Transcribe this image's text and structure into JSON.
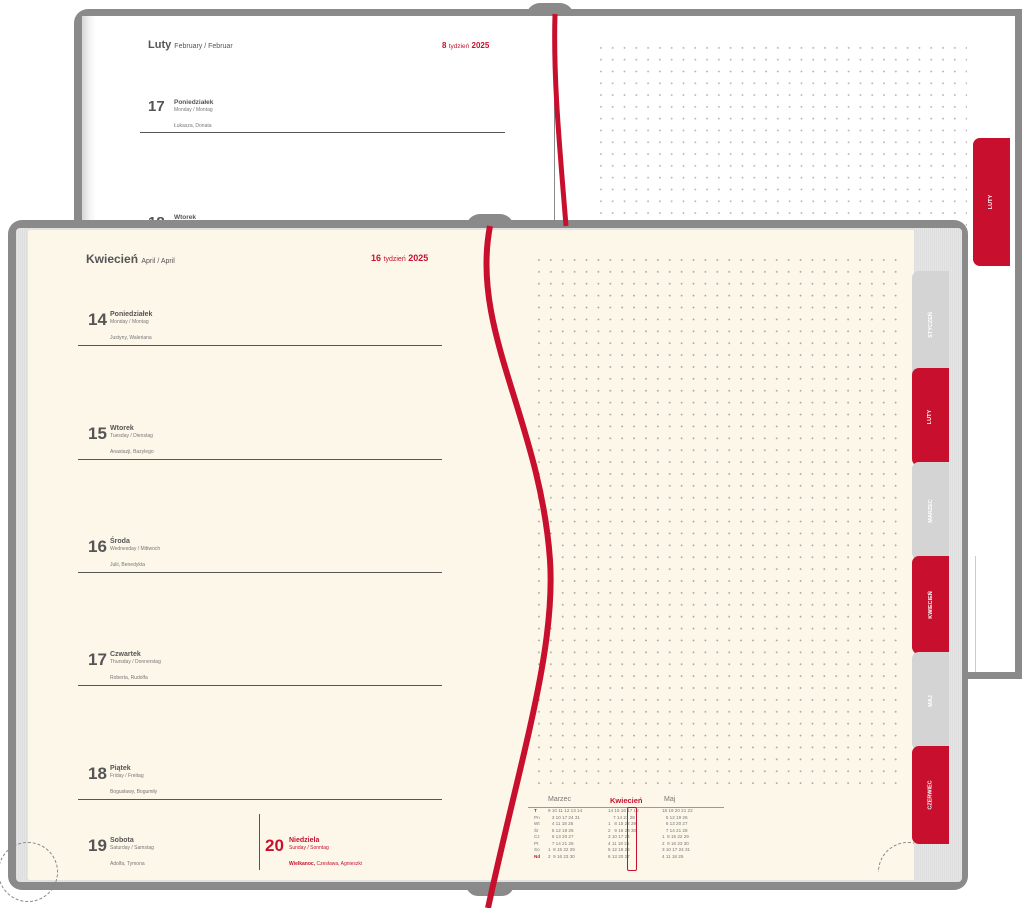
{
  "back_page": {
    "month": "Luty",
    "month_sub": "February / Februar",
    "week_num": "8",
    "week_word": "tydzień",
    "year": "2025",
    "day1": {
      "num": "17",
      "name": "Poniedziałek",
      "sub": "Monday / Montag",
      "names": "Łukasza, Donata"
    },
    "day2": {
      "num": "18",
      "name": "Wtorek"
    },
    "tab_label": "LUTY"
  },
  "front_page": {
    "month": "Kwiecień",
    "month_sub": "April / April",
    "week_num": "16",
    "week_word": "tydzień",
    "year": "2025",
    "days": [
      {
        "num": "14",
        "name": "Poniedziałek",
        "sub": "Monday / Montag",
        "names": "Justyny, Waleriana"
      },
      {
        "num": "15",
        "name": "Wtorek",
        "sub": "Tuesday / Dienstag",
        "names": "Anastazji, Bazylego"
      },
      {
        "num": "16",
        "name": "Środa",
        "sub": "Wednesday / Mittwoch",
        "names": "Julii, Benedykta"
      },
      {
        "num": "17",
        "name": "Czwartek",
        "sub": "Thursday / Donnerstag",
        "names": "Roberta, Rudolfa"
      },
      {
        "num": "18",
        "name": "Piątek",
        "sub": "Friday / Freitag",
        "names": "Bogusławy, Bogumiły"
      }
    ],
    "saturday": {
      "num": "19",
      "name": "Sobota",
      "sub": "Saturday / Samstag",
      "names": "Adolfa, Tymona"
    },
    "sunday": {
      "num": "20",
      "name": "Niedziela",
      "sub": "Sunday / Sonntag",
      "holiday": "Wielkanoc,",
      "names": "Czesława, Agnieszki"
    }
  },
  "tabs": [
    "STYCZEŃ",
    "LUTY",
    "MARZEC",
    "KWIECIEŃ",
    "MAJ",
    "CZERWIEC"
  ],
  "mini_calendar": {
    "months": [
      "Marzec",
      "Kwiecień",
      "Maj"
    ],
    "weekdays": [
      "T",
      "Pn",
      "Wt",
      "Śr",
      "Cz",
      "Pt",
      "So",
      "Nd"
    ],
    "marzec_cols": "9 10 11 12 13 14\n   3 10 17 24 31\n   4 11 18 25\n   5 12 19 26\n   6 13 20 27\n   7 14 21 28\n1  8 15 22 29\n2  9 16 23 30",
    "kwiecien_cols": "14 15 16 17 18\n    7 14 21 28\n1   8 15 22 29\n2   9 16 23 30\n3 10 17 24\n4 11 18 25\n5 12 19 26\n6 13 20 27",
    "maj_cols": "18 19 20 21 22\n   5 12 19 26\n   6 13 20 27\n   7 14 21 28\n1  8 15 22 29\n2  9 16 23 30\n3 10 17 24 31\n4 11 18 25"
  },
  "colors": {
    "accent": "#c8102e",
    "cover": "#8a8a8a",
    "cream": "#fdf7ea"
  }
}
